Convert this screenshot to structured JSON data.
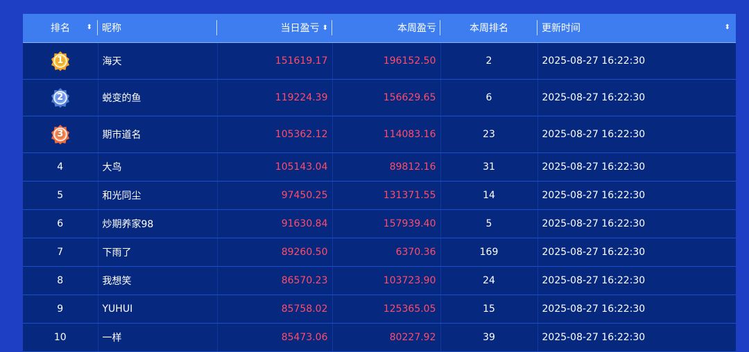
{
  "header": {
    "rank": "排名",
    "nickname": "昵称",
    "daily_pnl": "当日盈亏",
    "weekly_pnl": "本周盈亏",
    "weekly_rank": "本周排名",
    "updated_at": "更新时间"
  },
  "icons": {
    "sort": "sort-icon",
    "medal_1": "gold-medal-icon",
    "medal_2": "silver-medal-icon",
    "medal_3": "bronze-medal-icon"
  },
  "colors": {
    "background": "#1e3fc4",
    "header_bg": "#3d7df0",
    "row_bg": "#07287f",
    "pnl_text": "#ff4d6a",
    "gold": "#f5a623",
    "silver": "#4f7fd6",
    "bronze": "#f06a3a"
  },
  "rows": [
    {
      "rank": "1",
      "medal": true,
      "name": "海天",
      "daily": "151619.17",
      "weekly": "196152.50",
      "weekly_rank": "2",
      "time": "2025-08-27 16:22:30"
    },
    {
      "rank": "2",
      "medal": true,
      "name": "蜕变的鱼",
      "daily": "119224.39",
      "weekly": "156629.65",
      "weekly_rank": "6",
      "time": "2025-08-27 16:22:30"
    },
    {
      "rank": "3",
      "medal": true,
      "name": "期市道名",
      "daily": "105362.12",
      "weekly": "114083.16",
      "weekly_rank": "23",
      "time": "2025-08-27 16:22:30"
    },
    {
      "rank": "4",
      "name": "大鸟",
      "daily": "105143.04",
      "weekly": "89812.16",
      "weekly_rank": "31",
      "time": "2025-08-27 16:22:30"
    },
    {
      "rank": "5",
      "name": "和光同尘",
      "daily": "97450.25",
      "weekly": "131371.55",
      "weekly_rank": "14",
      "time": "2025-08-27 16:22:30"
    },
    {
      "rank": "6",
      "name": "炒期养家98",
      "daily": "91630.84",
      "weekly": "157939.40",
      "weekly_rank": "5",
      "time": "2025-08-27 16:22:30"
    },
    {
      "rank": "7",
      "name": "下雨了",
      "daily": "89260.50",
      "weekly": "6370.36",
      "weekly_rank": "169",
      "time": "2025-08-27 16:22:30"
    },
    {
      "rank": "8",
      "name": "我想笑",
      "daily": "86570.23",
      "weekly": "103723.90",
      "weekly_rank": "24",
      "time": "2025-08-27 16:22:30"
    },
    {
      "rank": "9",
      "name": "YUHUI",
      "daily": "85758.02",
      "weekly": "125365.05",
      "weekly_rank": "15",
      "time": "2025-08-27 16:22:30"
    },
    {
      "rank": "10",
      "name": "一样",
      "daily": "85473.06",
      "weekly": "80227.92",
      "weekly_rank": "39",
      "time": "2025-08-27 16:22:30"
    }
  ]
}
